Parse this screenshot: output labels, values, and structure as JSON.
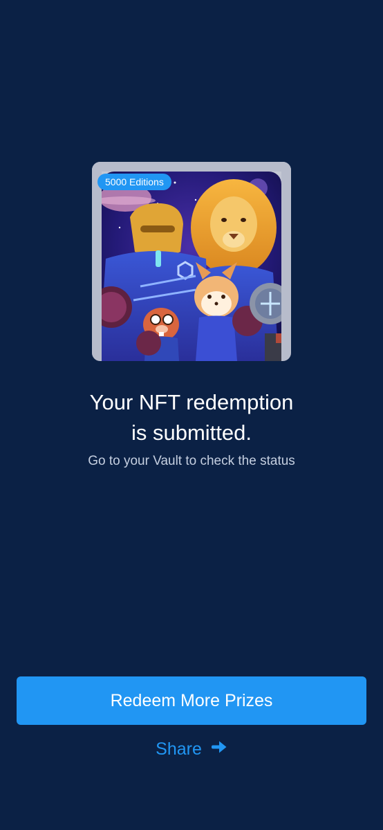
{
  "nft": {
    "badge": "5000 Editions",
    "image_icon": "nft-artwork-space-crew"
  },
  "confirmation": {
    "title_line1": "Your NFT redemption",
    "title_line2": "is submitted.",
    "subtitle": "Go to your Vault to check the status"
  },
  "actions": {
    "primary_label": "Redeem More Prizes",
    "share_label": "Share",
    "share_icon": "arrow-right-icon"
  },
  "colors": {
    "background": "#0b2145",
    "accent": "#2196f3",
    "text": "#ffffff",
    "muted_text": "#c5cfe0"
  }
}
